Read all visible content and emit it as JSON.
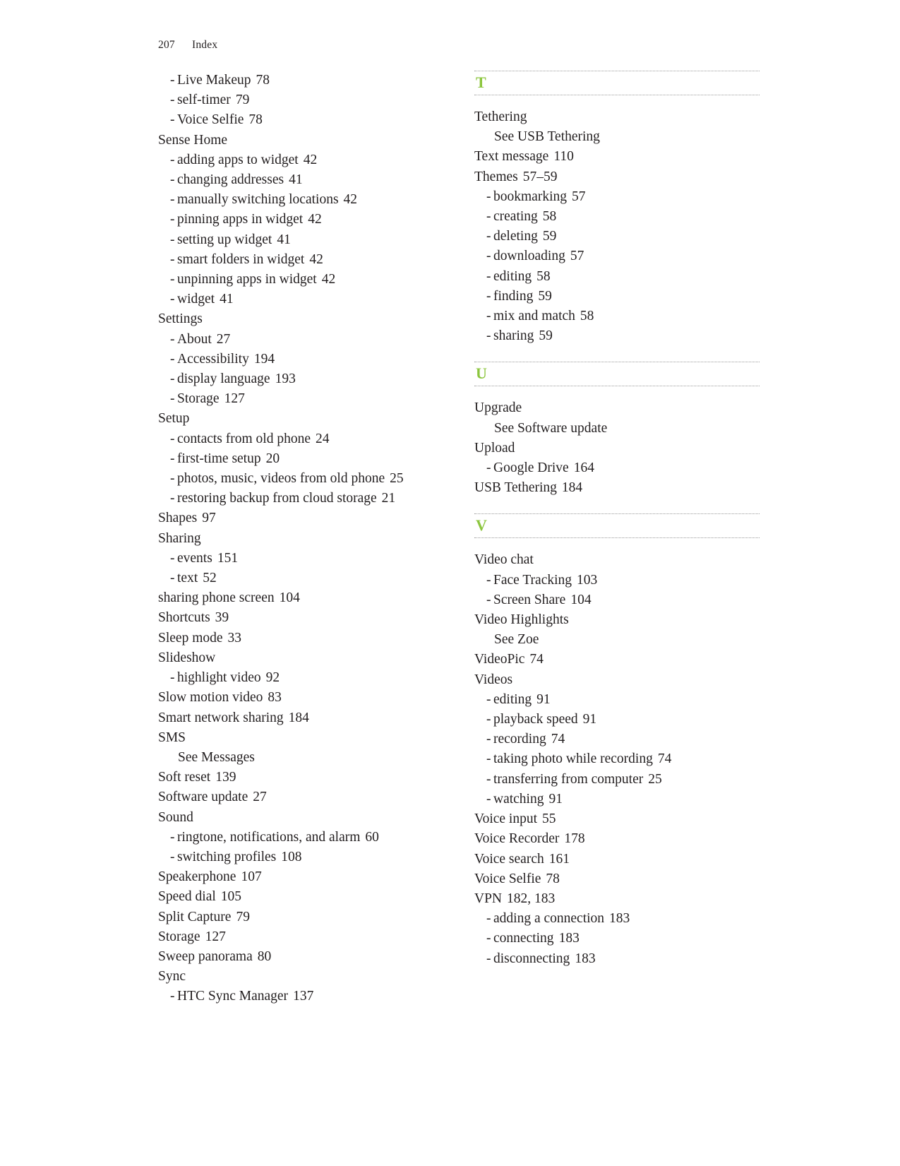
{
  "header": {
    "folio": "207",
    "label": "Index"
  },
  "theme": {
    "letter_color": "#8cc63e",
    "rule_color": "#9a9a9a",
    "text_color": "#231f20"
  },
  "columns": [
    {
      "name": "left-column",
      "blocks": [
        {
          "type": "entries",
          "entries": [
            {
              "level": 2,
              "dash": "-",
              "text": "Live Makeup",
              "page": "78"
            },
            {
              "level": 2,
              "dash": "-",
              "text": "self-timer",
              "page": "79"
            },
            {
              "level": 2,
              "dash": "-",
              "text": "Voice Selfie",
              "page": "78"
            },
            {
              "level": 1,
              "text": "Sense Home",
              "page": ""
            },
            {
              "level": 2,
              "dash": "-",
              "text": "adding apps to widget",
              "page": "42"
            },
            {
              "level": 2,
              "dash": "-",
              "text": "changing addresses",
              "page": "41"
            },
            {
              "level": 2,
              "dash": "-",
              "text": "manually switching locations",
              "page": "42"
            },
            {
              "level": 2,
              "dash": "-",
              "text": "pinning apps in widget",
              "page": "42"
            },
            {
              "level": 2,
              "dash": "-",
              "text": "setting up widget",
              "page": "41"
            },
            {
              "level": 2,
              "dash": "-",
              "text": "smart folders in widget",
              "page": "42"
            },
            {
              "level": 2,
              "dash": "-",
              "text": "unpinning apps in widget",
              "page": "42"
            },
            {
              "level": 2,
              "dash": "-",
              "text": "widget",
              "page": "41"
            },
            {
              "level": 1,
              "text": "Settings",
              "page": ""
            },
            {
              "level": 2,
              "dash": "-",
              "text": "About",
              "page": "27"
            },
            {
              "level": 2,
              "dash": "-",
              "text": "Accessibility",
              "page": "194"
            },
            {
              "level": 2,
              "dash": "-",
              "text": "display language",
              "page": "193"
            },
            {
              "level": 2,
              "dash": "-",
              "text": "Storage",
              "page": "127"
            },
            {
              "level": 1,
              "text": "Setup",
              "page": ""
            },
            {
              "level": 2,
              "dash": "-",
              "text": "contacts from old phone",
              "page": "24"
            },
            {
              "level": 2,
              "dash": "-",
              "text": "first-time setup",
              "page": "20"
            },
            {
              "level": 2,
              "dash": "-",
              "text": "photos, music, videos from old phone",
              "page": "25"
            },
            {
              "level": 2,
              "dash": "-",
              "text": "restoring backup from cloud storage",
              "page": "21"
            },
            {
              "level": 1,
              "text": "Shapes",
              "page": "97"
            },
            {
              "level": 1,
              "text": "Sharing",
              "page": ""
            },
            {
              "level": 2,
              "dash": "-",
              "text": "events",
              "page": "151"
            },
            {
              "level": 2,
              "dash": "-",
              "text": "text",
              "page": "52"
            },
            {
              "level": 1,
              "text": "sharing phone screen",
              "page": "104"
            },
            {
              "level": 1,
              "text": "Shortcuts",
              "page": "39"
            },
            {
              "level": 1,
              "text": "Sleep mode",
              "page": "33"
            },
            {
              "level": 1,
              "text": "Slideshow",
              "page": ""
            },
            {
              "level": 2,
              "dash": "-",
              "text": "highlight video",
              "page": "92"
            },
            {
              "level": 1,
              "text": "Slow motion video",
              "page": "83"
            },
            {
              "level": 1,
              "text": "Smart network sharing",
              "page": "184"
            },
            {
              "level": 1,
              "text": "SMS",
              "page": ""
            },
            {
              "level": 0,
              "text": "See Messages",
              "page": ""
            },
            {
              "level": 1,
              "text": "Soft reset",
              "page": "139"
            },
            {
              "level": 1,
              "text": "Software update",
              "page": "27"
            },
            {
              "level": 1,
              "text": "Sound",
              "page": ""
            },
            {
              "level": 2,
              "dash": "-",
              "text": "ringtone, notifications, and alarm",
              "page": "60"
            },
            {
              "level": 2,
              "dash": "-",
              "text": "switching profiles",
              "page": "108"
            },
            {
              "level": 1,
              "text": "Speakerphone",
              "page": "107"
            },
            {
              "level": 1,
              "text": "Speed dial",
              "page": "105"
            },
            {
              "level": 1,
              "text": "Split Capture",
              "page": "79"
            },
            {
              "level": 1,
              "text": "Storage",
              "page": "127"
            },
            {
              "level": 1,
              "text": "Sweep panorama",
              "page": "80"
            },
            {
              "level": 1,
              "text": "Sync",
              "page": ""
            },
            {
              "level": 2,
              "dash": "-",
              "text": "HTC Sync Manager",
              "page": "137"
            }
          ]
        }
      ]
    },
    {
      "name": "right-column",
      "blocks": [
        {
          "type": "letter",
          "letter": "T",
          "first": true
        },
        {
          "type": "entries",
          "entries": [
            {
              "level": 1,
              "text": "Tethering",
              "page": ""
            },
            {
              "level": 0,
              "text": "See USB Tethering",
              "page": ""
            },
            {
              "level": 1,
              "text": "Text message",
              "page": "110"
            },
            {
              "level": 1,
              "text": "Themes",
              "page": "57–59"
            },
            {
              "level": 2,
              "dash": "-",
              "text": "bookmarking",
              "page": "57"
            },
            {
              "level": 2,
              "dash": "-",
              "text": "creating",
              "page": "58"
            },
            {
              "level": 2,
              "dash": "-",
              "text": "deleting",
              "page": "59"
            },
            {
              "level": 2,
              "dash": "-",
              "text": "downloading",
              "page": "57"
            },
            {
              "level": 2,
              "dash": "-",
              "text": "editing",
              "page": "58"
            },
            {
              "level": 2,
              "dash": "-",
              "text": "finding",
              "page": "59"
            },
            {
              "level": 2,
              "dash": "-",
              "text": "mix and match",
              "page": "58"
            },
            {
              "level": 2,
              "dash": "-",
              "text": "sharing",
              "page": "59"
            }
          ]
        },
        {
          "type": "letter",
          "letter": "U",
          "first": false
        },
        {
          "type": "entries",
          "entries": [
            {
              "level": 1,
              "text": "Upgrade",
              "page": ""
            },
            {
              "level": 0,
              "text": "See Software update",
              "page": ""
            },
            {
              "level": 1,
              "text": "Upload",
              "page": ""
            },
            {
              "level": 2,
              "dash": "-",
              "text": "Google Drive",
              "page": "164"
            },
            {
              "level": 1,
              "text": "USB Tethering",
              "page": "184"
            }
          ]
        },
        {
          "type": "letter",
          "letter": "V",
          "first": false
        },
        {
          "type": "entries",
          "entries": [
            {
              "level": 1,
              "text": "Video chat",
              "page": ""
            },
            {
              "level": 2,
              "dash": "-",
              "text": "Face Tracking",
              "page": "103"
            },
            {
              "level": 2,
              "dash": "-",
              "text": "Screen Share",
              "page": "104"
            },
            {
              "level": 1,
              "text": "Video Highlights",
              "page": ""
            },
            {
              "level": 0,
              "text": "See Zoe",
              "page": ""
            },
            {
              "level": 1,
              "text": "VideoPic",
              "page": "74"
            },
            {
              "level": 1,
              "text": "Videos",
              "page": ""
            },
            {
              "level": 2,
              "dash": "-",
              "text": "editing",
              "page": "91"
            },
            {
              "level": 2,
              "dash": "-",
              "text": "playback speed",
              "page": "91"
            },
            {
              "level": 2,
              "dash": "-",
              "text": "recording",
              "page": "74"
            },
            {
              "level": 2,
              "dash": "-",
              "text": "taking photo while recording",
              "page": "74"
            },
            {
              "level": 2,
              "dash": "-",
              "text": "transferring from computer",
              "page": "25"
            },
            {
              "level": 2,
              "dash": "-",
              "text": "watching",
              "page": "91"
            },
            {
              "level": 1,
              "text": "Voice input",
              "page": "55"
            },
            {
              "level": 1,
              "text": "Voice Recorder",
              "page": "178"
            },
            {
              "level": 1,
              "text": "Voice search",
              "page": "161"
            },
            {
              "level": 1,
              "text": "Voice Selfie",
              "page": "78"
            },
            {
              "level": 1,
              "text": "VPN",
              "page": "182, 183"
            },
            {
              "level": 2,
              "dash": "-",
              "text": "adding a connection",
              "page": "183"
            },
            {
              "level": 2,
              "dash": "-",
              "text": "connecting",
              "page": "183"
            },
            {
              "level": 2,
              "dash": "-",
              "text": "disconnecting",
              "page": "183"
            }
          ]
        }
      ]
    }
  ]
}
